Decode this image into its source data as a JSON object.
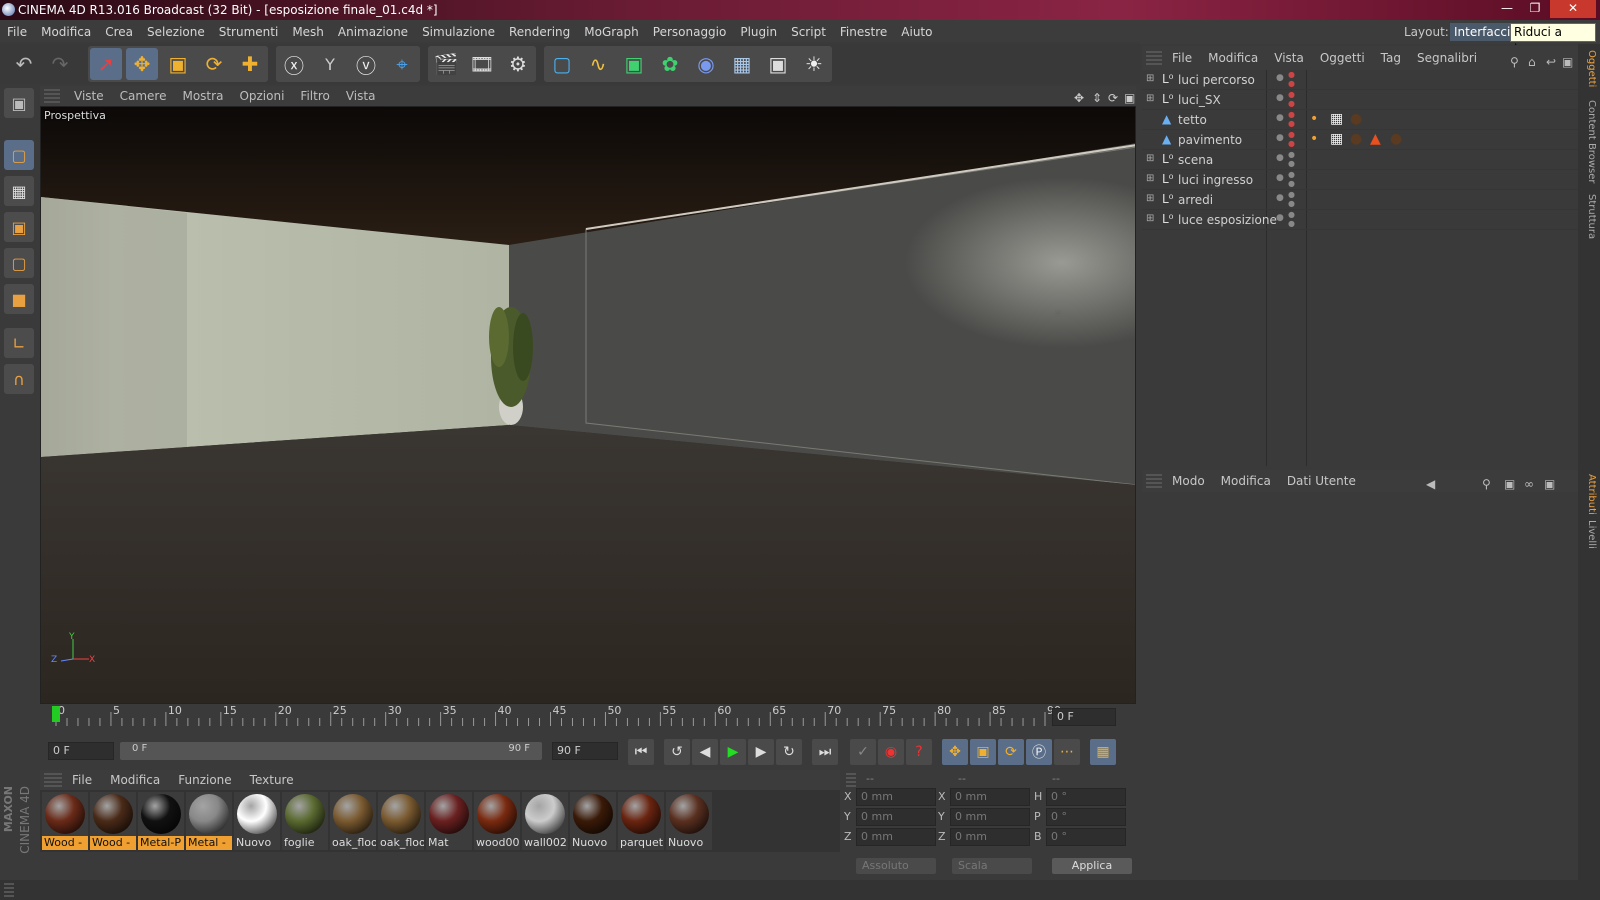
{
  "window": {
    "title": "CINEMA 4D R13.016 Broadcast (32 Bit) - [esposizione finale_01.c4d *]",
    "minimize_icon": "minimize-icon",
    "restore_icon": "restore-icon",
    "close_icon": "close-icon"
  },
  "menubar": {
    "items": [
      "File",
      "Modifica",
      "Crea",
      "Selezione",
      "Strumenti",
      "Mesh",
      "Animazione",
      "Simulazione",
      "Rendering",
      "MoGraph",
      "Personaggio",
      "Plugin",
      "Script",
      "Finestre",
      "Aiuto"
    ]
  },
  "layout": {
    "label": "Layout:",
    "value": "Interfaccia",
    "tooltip": "Riduci a icona"
  },
  "toolbar": {
    "icons": [
      "undo-icon",
      "redo-icon",
      "select-icon",
      "move-icon",
      "scale-icon",
      "rotate-icon",
      "add-icon",
      "x-axis-icon",
      "y-axis-icon",
      "z-axis-icon",
      "coordinate-system-icon",
      "render-view-icon",
      "render-picture-viewer-icon",
      "render-settings-icon",
      "cube-icon",
      "spline-icon",
      "nurbs-icon",
      "array-icon",
      "deformer-icon",
      "floor-icon",
      "camera-icon",
      "light-icon"
    ],
    "y_label": "Y"
  },
  "left_tools": {
    "icons": [
      "make-editable-icon",
      "model-mode-icon",
      "texture-mode-icon",
      "points-mode-icon",
      "edges-mode-icon",
      "polygons-mode-icon",
      "axis-mode-icon",
      "magnet-icon"
    ]
  },
  "viewport": {
    "menu": [
      "Viste",
      "Camere",
      "Mostra",
      "Opzioni",
      "Filtro",
      "Vista"
    ],
    "label": "Prospettiva",
    "axis": {
      "x": "X",
      "y": "Y",
      "z": "Z"
    }
  },
  "timeline": {
    "ticks": [
      "0",
      "5",
      "10",
      "15",
      "20",
      "25",
      "30",
      "35",
      "40",
      "45",
      "50",
      "55",
      "60",
      "65",
      "70",
      "75",
      "80",
      "85",
      "90"
    ],
    "current_frame": "0 F",
    "start_frame": "0 F",
    "range_start": "0 F",
    "range_end": "90 F",
    "end_frame": "90 F"
  },
  "materials": {
    "menu": [
      "File",
      "Modifica",
      "Funzione",
      "Texture"
    ],
    "items": [
      {
        "name": "Wood -",
        "selected": true,
        "color": "#6a2a18"
      },
      {
        "name": "Wood -",
        "selected": true,
        "color": "#4a2a18"
      },
      {
        "name": "Metal-P",
        "selected": true,
        "color": "#111111"
      },
      {
        "name": "Metal -",
        "selected": true,
        "color": "#888888"
      },
      {
        "name": "Nuovo",
        "selected": false,
        "color": "#ffffff"
      },
      {
        "name": "foglie",
        "selected": false,
        "color": "#5a6a30"
      },
      {
        "name": "oak_floo",
        "selected": false,
        "color": "#7a5a30"
      },
      {
        "name": "oak_floo",
        "selected": false,
        "color": "#7a5a30"
      },
      {
        "name": "Mat",
        "selected": false,
        "color": "#6a2020"
      },
      {
        "name": "wood00",
        "selected": false,
        "color": "#7a2a10"
      },
      {
        "name": "wall002",
        "selected": false,
        "color": "#cccccc"
      },
      {
        "name": "Nuovo",
        "selected": false,
        "color": "#3a1a08"
      },
      {
        "name": "parquet",
        "selected": false,
        "color": "#6a2410"
      },
      {
        "name": "Nuovo",
        "selected": false,
        "color": "#5a3020"
      }
    ]
  },
  "coordinates": {
    "headers": [
      "--",
      "--",
      "--"
    ],
    "rows": [
      {
        "a": "X",
        "a_val": "0 mm",
        "b": "X",
        "b_val": "0 mm",
        "c": "H",
        "c_val": "0 °"
      },
      {
        "a": "Y",
        "a_val": "0 mm",
        "b": "Y",
        "b_val": "0 mm",
        "c": "P",
        "c_val": "0 °"
      },
      {
        "a": "Z",
        "a_val": "0 mm",
        "b": "Z",
        "b_val": "0 mm",
        "c": "B",
        "c_val": "0 °"
      }
    ],
    "mode": "Assoluto",
    "scale": "Scala",
    "apply": "Applica"
  },
  "brand": {
    "line1": "MAXON",
    "line2": "CINEMA 4D"
  },
  "objects_panel": {
    "menu": [
      "File",
      "Modifica",
      "Vista",
      "Oggetti",
      "Tag",
      "Segnalibri"
    ],
    "items": [
      {
        "name": "luci percorso",
        "type": "null-icon",
        "tags": []
      },
      {
        "name": "luci_SX",
        "type": "null-icon",
        "tags": []
      },
      {
        "name": "tetto",
        "type": "object-icon",
        "tags": [
          "phong-tag-icon",
          "texture-tag-icon",
          "material-tag-icon"
        ]
      },
      {
        "name": "pavimento",
        "type": "object-icon",
        "tags": [
          "phong-tag-icon",
          "texture-tag-icon",
          "material-tag-icon",
          "warning-tag-icon",
          "material-tag-icon"
        ]
      },
      {
        "name": "scena",
        "type": "null-icon",
        "tags": []
      },
      {
        "name": "luci ingresso",
        "type": "null-icon",
        "tags": []
      },
      {
        "name": "arredi",
        "type": "null-icon",
        "tags": []
      },
      {
        "name": "luce esposizione",
        "type": "null-icon",
        "tags": []
      }
    ]
  },
  "attributes_panel": {
    "menu": [
      "Modo",
      "Modifica",
      "Dati Utente"
    ]
  },
  "side_tabs": {
    "top": [
      "Oggetti",
      "Content Browser",
      "Struttura"
    ],
    "bottom": [
      "Attributi",
      "Livelli"
    ]
  }
}
